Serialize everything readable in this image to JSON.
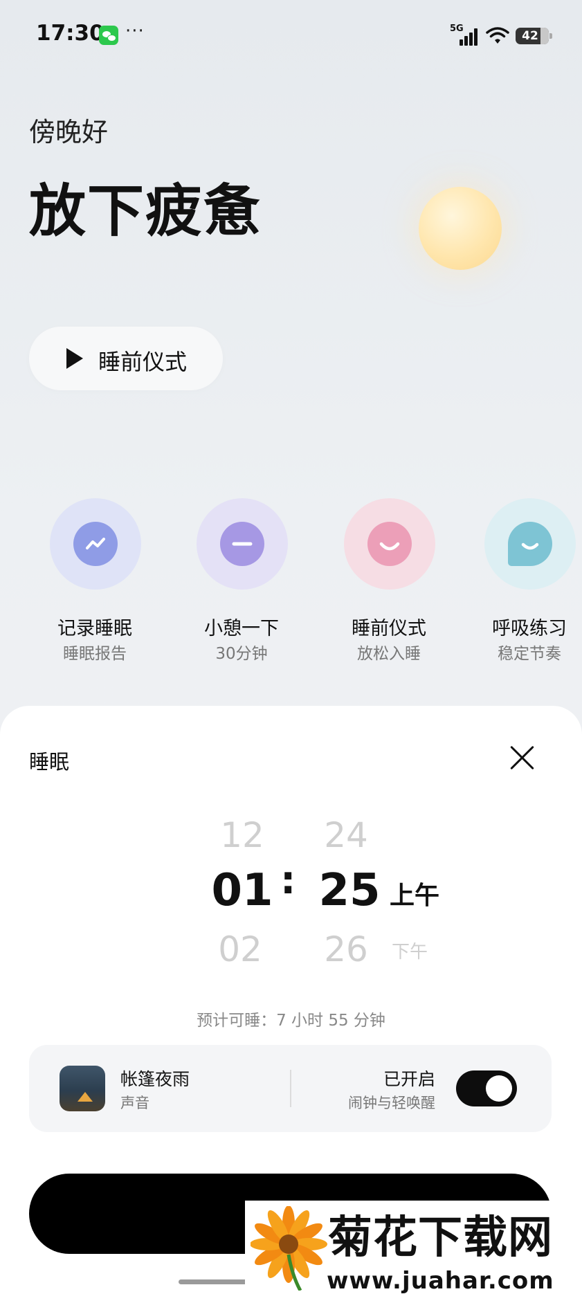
{
  "status_bar": {
    "time": "17:30",
    "more": "···",
    "network": "5G",
    "battery": "42",
    "icons": [
      "wechat-icon",
      "signal-icon",
      "wifi-icon",
      "battery-icon"
    ]
  },
  "hero": {
    "greeting": "傍晚好",
    "title": "放下疲惫",
    "ritual_button": "睡前仪式"
  },
  "features": [
    {
      "name": "记录睡眠",
      "sub": "睡眠报告",
      "icon": "trend-icon",
      "color": "#8f9ce6"
    },
    {
      "name": "小憩一下",
      "sub": "30分钟",
      "icon": "minus-icon",
      "color": "#a698e4"
    },
    {
      "name": "睡前仪式",
      "sub": "放松入睡",
      "icon": "smile-icon",
      "color": "#ec9fb8"
    },
    {
      "name": "呼吸练习",
      "sub": "稳定节奏",
      "icon": "chat-smile-icon",
      "color": "#7ec4d4"
    }
  ],
  "sheet": {
    "title": "睡眠",
    "picker": {
      "hour_prev": "12",
      "hour": "01",
      "hour_next": "02",
      "separator": ":",
      "minute_prev": "24",
      "minute": "25",
      "minute_next": "26",
      "ampm_selected": "上午",
      "ampm_other": "下午"
    },
    "estimate": "预计可睡：7 小时 55 分钟",
    "sound": {
      "name": "帐篷夜雨",
      "label": "声音"
    },
    "alarm": {
      "status": "已开启",
      "label": "闹钟与轻唤醒",
      "enabled": true
    }
  },
  "watermark": {
    "title": "菊花下载网",
    "url": "www.juahar.com"
  },
  "colors": {
    "accent": "#000000",
    "moon": "#fbd88f"
  }
}
